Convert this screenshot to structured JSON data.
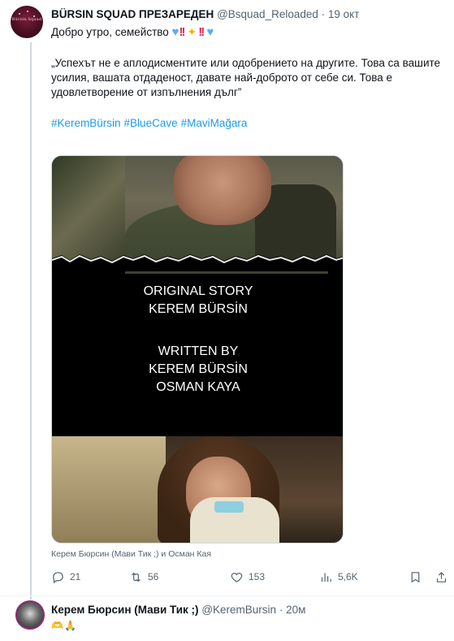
{
  "tweet": {
    "author_name": "BÜRSIN SQUAD ПРЕЗАРЕДЕН",
    "author_handle": "@Bsquad_Reloaded",
    "separator": "·",
    "time": "19 окт",
    "avatar_text": "Bürsin Squad",
    "greeting": "Добро утро, семейство",
    "greeting_emojis": [
      "blue-heart",
      "double-exclamation",
      "sparkles",
      "double-exclamation",
      "blue-heart"
    ],
    "quote": "„Успехът не е аплодисментите или одобрението на другите. Това са вашите усилия, вашата отдаденост, давате най-доброто от себе си. Това е удовлетворение от изпълнения дълг”",
    "hashtags": [
      "#KeremBürsin",
      "#BlueCave",
      "#MaviMağara"
    ],
    "media": {
      "line1": "ORIGINAL STORY",
      "line2": "KEREM BÜRSİN",
      "line3": "WRITTEN BY",
      "line4": "KEREM BÜRSİN",
      "line5": "OSMAN KAYA"
    },
    "media_caption": "Керем Бюрсин (Мави Тик ;) и Осман Кая",
    "actions": {
      "replies": "21",
      "retweets": "56",
      "likes": "153",
      "views": "5,6K"
    }
  },
  "reply": {
    "author_name": "Керем Бюрсин (Мави Тик ;)",
    "author_handle": "@KeremBursin",
    "separator": "·",
    "time": "20м",
    "text": "🫶🙏"
  },
  "colors": {
    "link": "#1d9bf0",
    "muted": "#536471",
    "text": "#0f1419",
    "thread_line": "#cfd9de"
  }
}
